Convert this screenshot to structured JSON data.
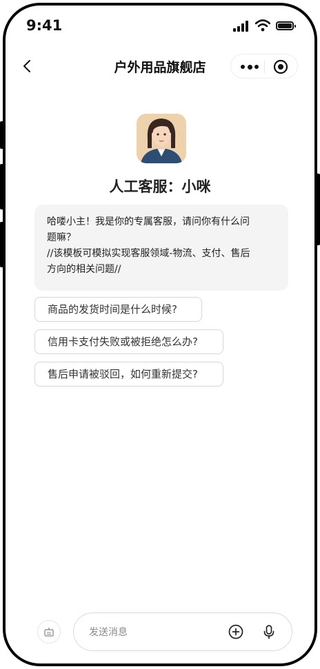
{
  "status_bar": {
    "time": "9:41",
    "icons": [
      "signal-icon",
      "wifi-icon",
      "battery-icon"
    ]
  },
  "nav": {
    "title": "户外用品旗舰店",
    "back_icon": "chevron-left-icon",
    "capsule_icons": [
      "more-icon",
      "target-icon"
    ]
  },
  "agent": {
    "name": "人工客服：小咪",
    "avatar_icon": "avatar"
  },
  "message": {
    "line1": "哈喽小主！我是你的专属客服，请问你有什么问",
    "line2": "题嘛？",
    "line3": "//该模板可模拟实现客服领域-物流、支付、售后",
    "line4": "方向的相关问题//"
  },
  "quick_questions": [
    "商品的发货时间是什么时候?",
    "信用卡支付失败或被拒绝怎么办?",
    "售后申请被驳回，如何重新提交?"
  ],
  "input_bar": {
    "placeholder": "发送消息",
    "value": "",
    "icons": [
      "keyboard-icon",
      "plus-circle-icon",
      "mic-icon"
    ]
  },
  "colors": {
    "bubble_bg": "#f4f4f5",
    "border": "#d6d6d6",
    "text": "#222222"
  }
}
